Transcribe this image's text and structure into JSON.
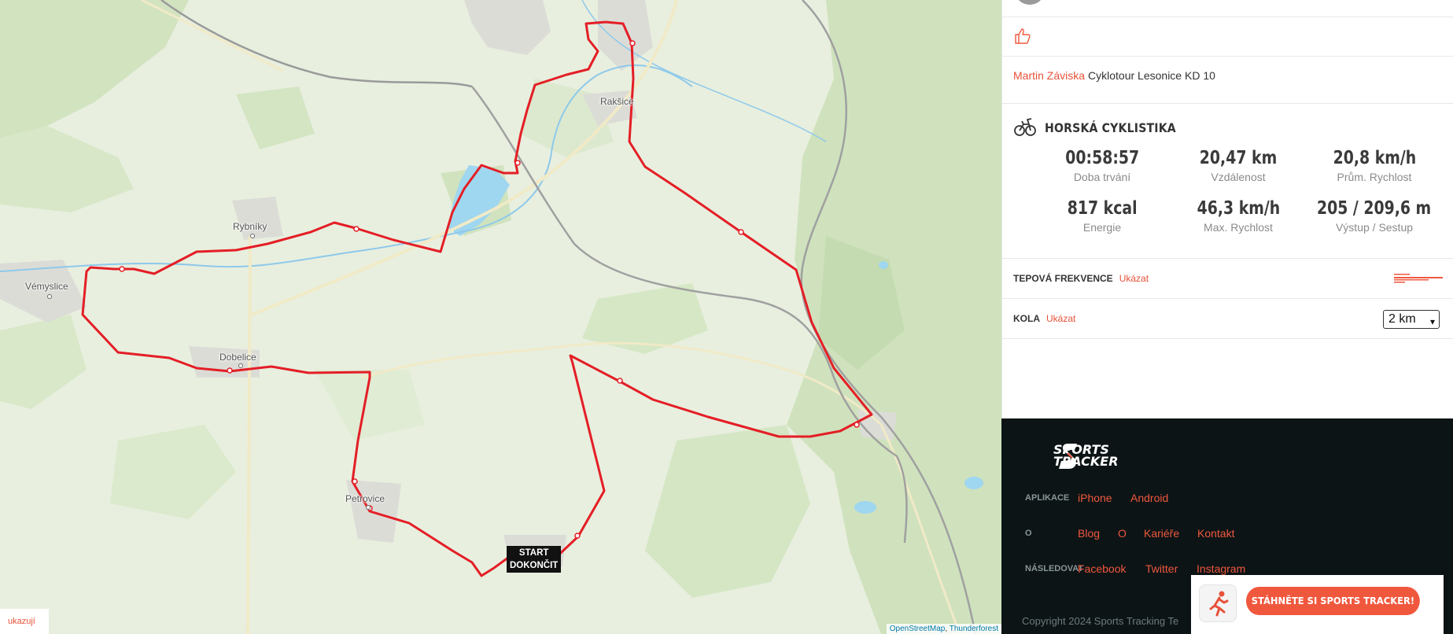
{
  "map": {
    "places": [
      "Rakšice",
      "Rybníky",
      "Vémyslice",
      "Dobelice",
      "Petrovice"
    ],
    "start_label": "START",
    "finish_label": "DOKONČIT",
    "attribution": {
      "osm": "OpenStreetMap",
      "sep": ",",
      "tf": "Thunderforest"
    },
    "showing_link": "ukazují",
    "route_color": "#e41e26"
  },
  "workout": {
    "author": "Martin Záviska",
    "title": "Cyklotour Lesonice KD 10",
    "sport": "HORSKÁ CYKLISTIKA",
    "sport_icon": "mountain-bike-icon",
    "stats": [
      {
        "value": "00:58:57",
        "label": "Doba trvání"
      },
      {
        "value": "20,47  km",
        "label": "Vzdálenost"
      },
      {
        "value": "20,8  km/h",
        "label": "Prům. Rychlost"
      },
      {
        "value": "817 kcal",
        "label": "Energie"
      },
      {
        "value": "46,3  km/h",
        "label": "Max. Rychlost"
      },
      {
        "value": "205 / 209,6  m",
        "label": "Výstup / Sestup"
      }
    ]
  },
  "heart_rate": {
    "title": "TEPOVÁ FREKVENCE",
    "link": "Ukázat"
  },
  "laps": {
    "title": "KOLA",
    "link": "Ukázat",
    "selected": "2 km"
  },
  "footer": {
    "logo_line1": "SPORTS",
    "logo_line2": "TRACKER",
    "apps_label": "APLIKACE",
    "apps": [
      "iPhone",
      "Android"
    ],
    "about_label": "O",
    "about": [
      "Blog",
      "O",
      "Kariéře",
      "Kontakt"
    ],
    "follow_label": "NÁSLEDOVAT",
    "follow": [
      "Facebook",
      "Twitter",
      "Instagram"
    ],
    "copyright": "Copyright 2024 Sports Tracking Te"
  },
  "banner": {
    "button": "STÁHNĚTE SI SPORTS TRACKER!"
  },
  "colors": {
    "accent": "#f0583e",
    "footer_bg": "#0c1416",
    "route": "#e41e26"
  }
}
